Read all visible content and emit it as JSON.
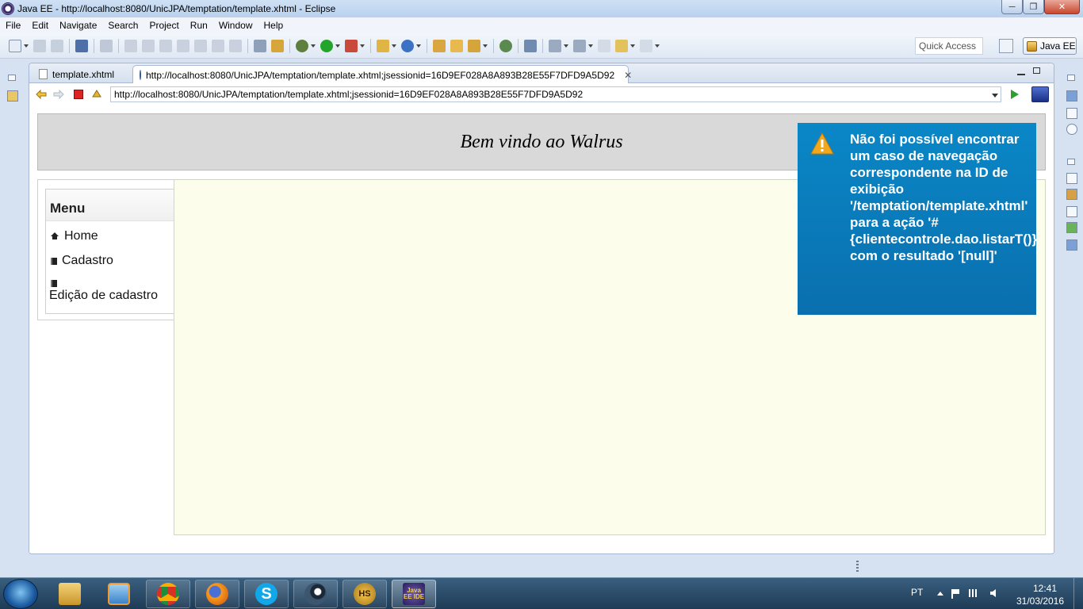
{
  "window": {
    "title": "Java EE - http://localhost:8080/UnicJPA/temptation/template.xhtml - Eclipse"
  },
  "menubar": {
    "items": [
      "File",
      "Edit",
      "Navigate",
      "Search",
      "Project",
      "Run",
      "Window",
      "Help"
    ]
  },
  "toolbar": {
    "quick_access": "Quick Access",
    "perspective": "Java EE"
  },
  "editor": {
    "tabs": [
      {
        "label": "template.xhtml",
        "active": false
      },
      {
        "label": "http://localhost:8080/UnicJPA/temptation/template.xhtml;jsessionid=16D9EF028A8A893B28E55F7DFD9A5D92",
        "active": true
      }
    ],
    "url": "http://localhost:8080/UnicJPA/temptation/template.xhtml;jsessionid=16D9EF028A8A893B28E55F7DFD9A5D92"
  },
  "webpage": {
    "header": "Bem vindo ao Walrus",
    "menu": {
      "title": "Menu",
      "items": [
        "Home",
        "Cadastro",
        "Edição de cadastro"
      ]
    },
    "growl": {
      "message": "Não foi possível encontrar um caso de navegação correspondente na ID de exibição '/temptation/template.xhtml' para a ação '#{clientecontrole.dao.listarT()}' com o resultado '[null]'"
    }
  },
  "taskbar": {
    "apps": [
      "explorer-icon",
      "media-player-icon",
      "chrome-icon",
      "firefox-icon",
      "skype-icon",
      "steam-icon",
      "hs-icon",
      "eclipse-javaee-icon"
    ],
    "hs_label": "HS",
    "eclipse_label": "Java EE IDE",
    "language": "PT",
    "time": "12:41",
    "date": "31/03/2016"
  },
  "colors": {
    "growl_bg": "#0a7ebf",
    "content_bg": "#fcfdea",
    "header_bg": "#d9d9d9",
    "warning": "#f2a81d"
  }
}
